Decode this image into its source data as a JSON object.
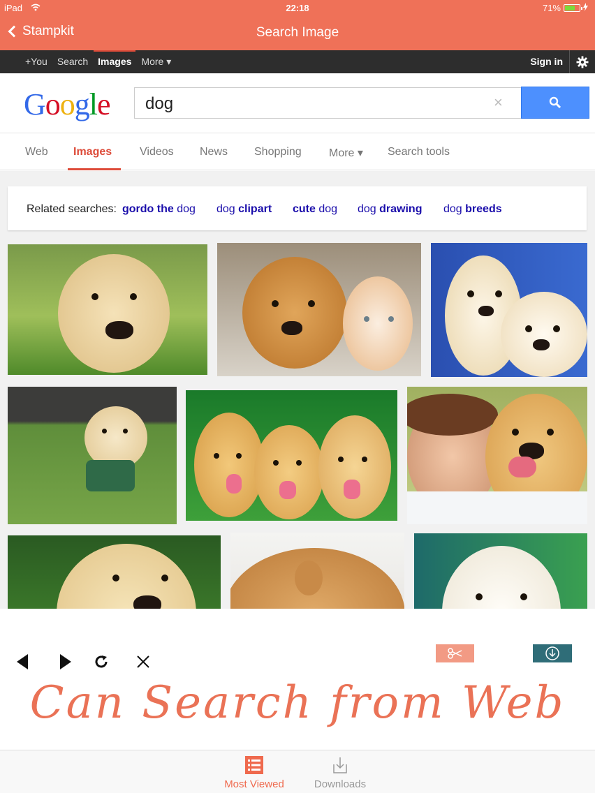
{
  "status": {
    "device": "iPad",
    "time": "22:18",
    "battery": "71%",
    "battery_level": 0.71
  },
  "app": {
    "back_label": "Stampkit",
    "title": "Search Image"
  },
  "google_bar": {
    "items": [
      "+You",
      "Search",
      "Images",
      "More ▾"
    ],
    "active_index": 2,
    "signin": "Sign in"
  },
  "search": {
    "logo_letters": [
      "G",
      "o",
      "o",
      "g",
      "l",
      "e"
    ],
    "logo_colors": [
      "#3369e8",
      "#d50f25",
      "#eeb211",
      "#3369e8",
      "#009925",
      "#d50f25"
    ],
    "query": "dog",
    "clear": "×"
  },
  "tabs": [
    "Web",
    "Images",
    "Videos",
    "News",
    "Shopping",
    "More ▾",
    "Search tools"
  ],
  "related": {
    "label": "Related searches:",
    "items": [
      {
        "bold": "gordo the",
        "normal": " dog"
      },
      {
        "normal": "dog ",
        "bold": "clipart"
      },
      {
        "bold": "cute",
        "normal": " dog"
      },
      {
        "normal": "dog ",
        "bold": "drawing"
      },
      {
        "normal": "dog ",
        "bold": "breeds"
      }
    ]
  },
  "images": [
    {
      "name": "labrador-puppy-grass"
    },
    {
      "name": "puppy-and-kitten"
    },
    {
      "name": "two-white-puppies"
    },
    {
      "name": "guide-dog-puppy"
    },
    {
      "name": "three-golden-puppies"
    },
    {
      "name": "woman-with-golden-retriever"
    },
    {
      "name": "labrador-closeup"
    },
    {
      "name": "sleeping-puppy"
    },
    {
      "name": "white-puppy-green"
    }
  ],
  "tagline": "Can Search from Web",
  "tabbar": {
    "most_viewed": "Most Viewed",
    "downloads": "Downloads",
    "active_color": "#ef6a4e"
  }
}
